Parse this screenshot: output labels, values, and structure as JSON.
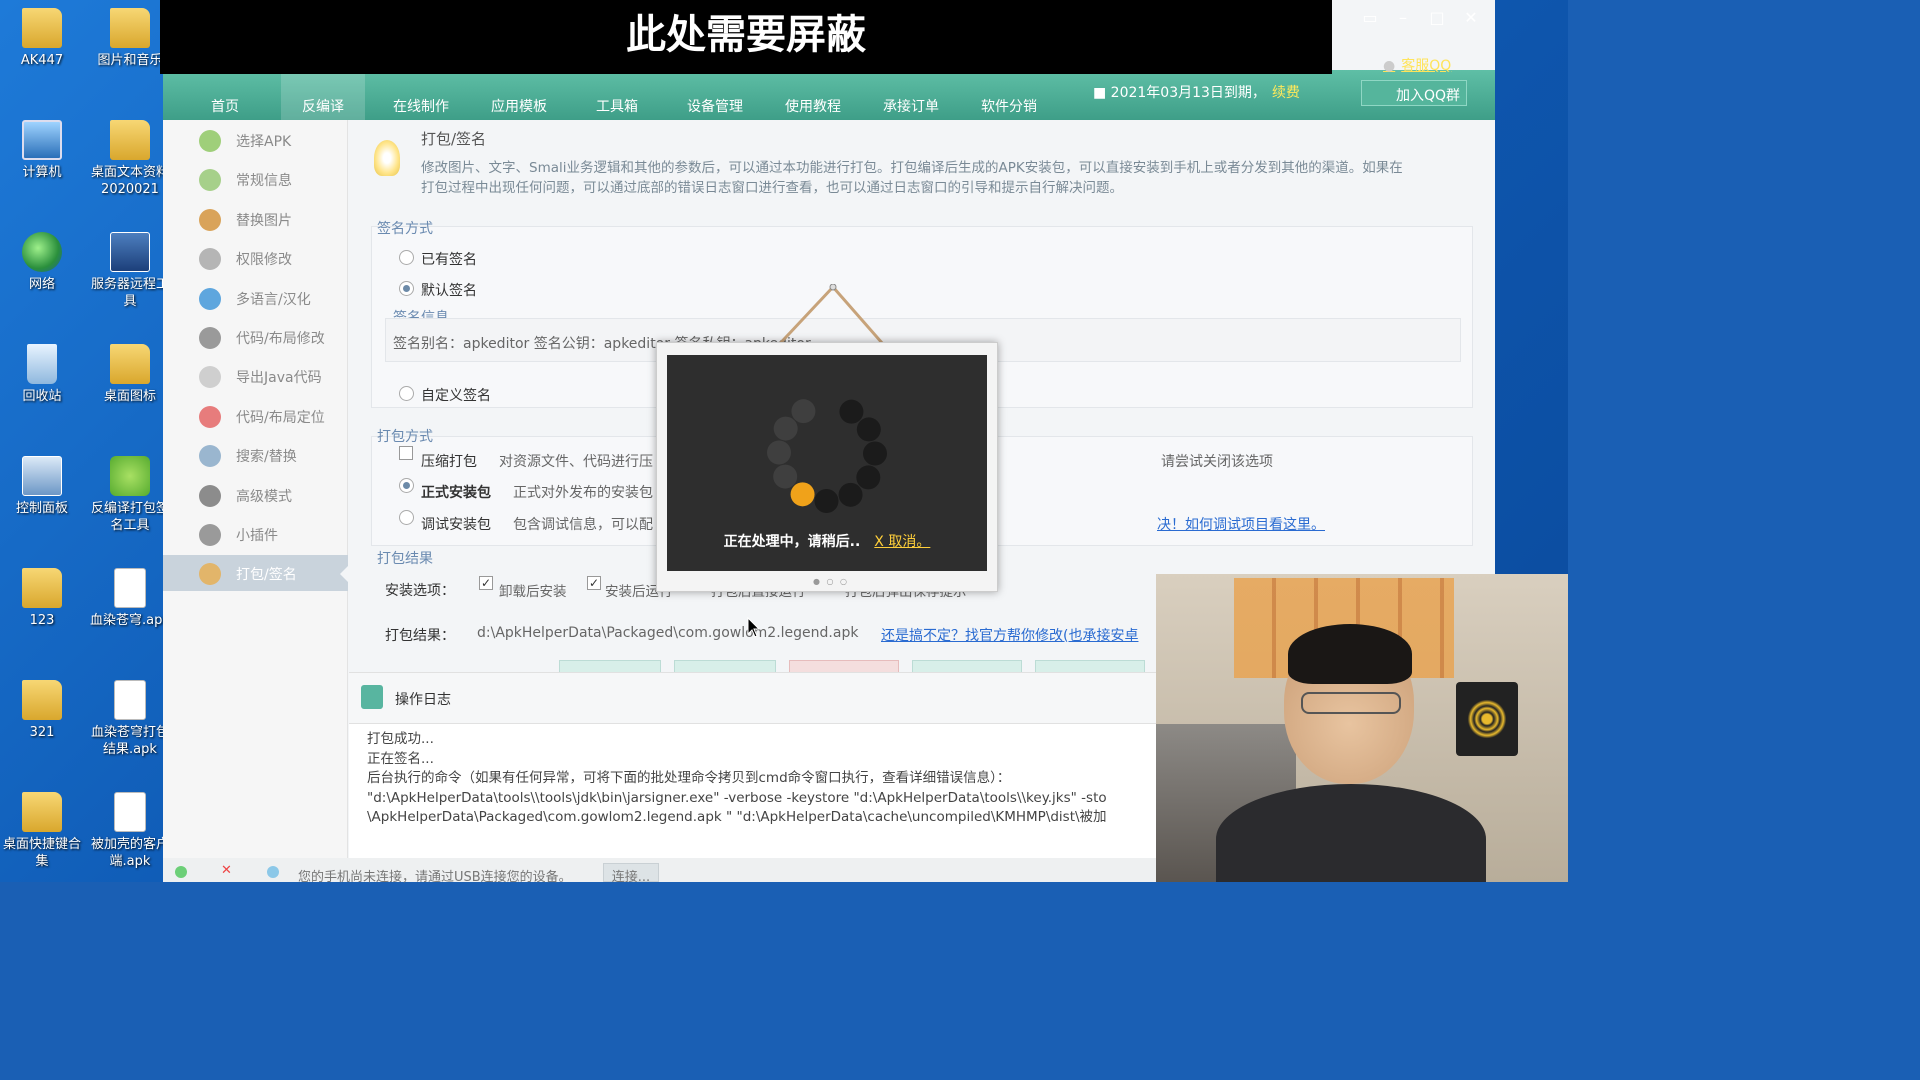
{
  "mask": {
    "text": "此处需要屏蔽"
  },
  "desktop": {
    "icons": [
      {
        "label": "AK447"
      },
      {
        "label": "图片和音乐"
      },
      {
        "label": "计算机"
      },
      {
        "label": "桌面文本资料2020021"
      },
      {
        "label": "网络"
      },
      {
        "label": "服务器远程工具"
      },
      {
        "label": "回收站"
      },
      {
        "label": "桌面图标"
      },
      {
        "label": "控制面板"
      },
      {
        "label": "反编译打包签名工具"
      },
      {
        "label": "123"
      },
      {
        "label": "血染苍穹.apk"
      },
      {
        "label": "321"
      },
      {
        "label": "血染苍穹打包结果.apk"
      },
      {
        "label": "桌面快捷键合集"
      },
      {
        "label": "被加壳的客户端.apk"
      }
    ]
  },
  "toolbar": {
    "items": [
      "首页",
      "反编译",
      "在线制作",
      "应用模板",
      "工具箱",
      "设备管理",
      "使用教程",
      "承接订单",
      "软件分销"
    ],
    "active_index": 1,
    "expiry": "■ 2021年03月13日到期，",
    "renew": "续费",
    "kefu": "客服QQ",
    "join_qq": "加入QQ群"
  },
  "sidebar": {
    "items": [
      {
        "label": "选择APK",
        "icon": "android-icon"
      },
      {
        "label": "常规信息",
        "icon": "gear-icon"
      },
      {
        "label": "替换图片",
        "icon": "image-icon"
      },
      {
        "label": "权限修改",
        "icon": "info-icon"
      },
      {
        "label": "多语言/汉化",
        "icon": "globe-icon"
      },
      {
        "label": "代码/布局修改",
        "icon": "code-icon"
      },
      {
        "label": "导出Java代码",
        "icon": "file-icon"
      },
      {
        "label": "代码/布局定位",
        "icon": "pin-icon"
      },
      {
        "label": "搜索/替换",
        "icon": "search-icon"
      },
      {
        "label": "高级模式",
        "icon": "tools-icon"
      },
      {
        "label": "小插件",
        "icon": "plugin-icon"
      },
      {
        "label": "打包/签名",
        "icon": "package-icon"
      }
    ],
    "active_index": 11
  },
  "main": {
    "title": "打包/签名",
    "description_line1": "修改图片、文字、Smali业务逻辑和其他的参数后，可以通过本功能进行打包。打包编译后生成的APK安装包，可以直接安装到手机上或者分发到其他的渠道。如果在",
    "description_line2": "打包过程中出现任何问题，可以通过底部的错误日志窗口进行查看，也可以通过日志窗口的引导和提示自行解决问题。",
    "sign": {
      "section": "签名方式",
      "opt_existing": "已有签名",
      "opt_default": "默认签名",
      "info_title": "签名信息",
      "info_text": "签名别名：apkeditor   签名公钥：apkeditor   签名私钥：apkeditor",
      "opt_custom": "自定义签名"
    },
    "pack": {
      "section": "打包方式",
      "compress_label": "压缩打包",
      "compress_desc": "对资源文件、代码进行压",
      "compress_tail": "请尝试关闭该选项",
      "release_label": "正式安装包",
      "release_desc": "正式对外发布的安装包",
      "debug_label": "调试安装包",
      "debug_desc": "包含调试信息，可以配",
      "debug_link": "决！如何调试项目看这里。"
    },
    "result": {
      "section": "打包结果",
      "install_label": "安装选项：",
      "opt_uninstall": "卸载后安装",
      "opt_run": "安装后运行",
      "opt_open_dir": "打包后直接运行",
      "opt_popup": "打包后弹出保存提示",
      "result_label": "打包结果：",
      "result_path": "d:\\ApkHelperData\\Packaged\\com.gowlom2.legend.apk",
      "help_link": "还是搞不定？找官方帮你修改(也承接安卓"
    },
    "log": {
      "title": "操作日志",
      "lines": [
        "打包成功...",
        "正在签名...",
        "后台执行的命令（如果有任何异常，可将下面的批处理命令拷贝到cmd命令窗口执行，查看详细错误信息）：",
        "\"d:\\ApkHelperData\\tools\\\\tools\\jdk\\bin\\jarsigner.exe\" -verbose -keystore \"d:\\ApkHelperData\\tools\\\\key.jks\" -sto",
        "\\ApkHelperData\\Packaged\\com.gowlom2.legend.apk \" \"d:\\ApkHelperData\\cache\\uncompiled\\KMHMP\\dist\\被加"
      ]
    }
  },
  "popup": {
    "loading_text": "正在处理中，请稍后..",
    "cancel": "X 取消。"
  },
  "status": {
    "message": "您的手机尚未连接，请通过USB连接您的设备。",
    "connect": "连接..."
  }
}
